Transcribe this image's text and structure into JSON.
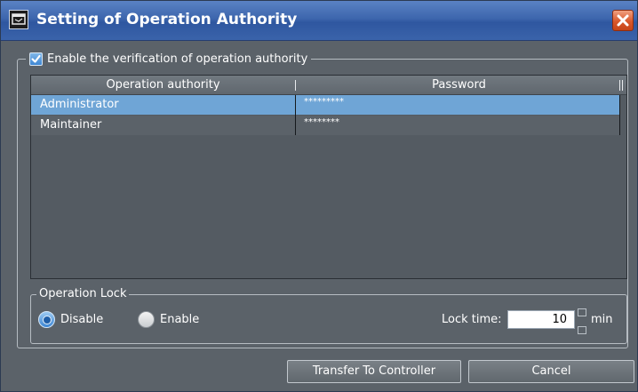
{
  "window": {
    "title": "Setting of Operation Authority"
  },
  "verification": {
    "checkbox_label": "Enable the verification of operation authority",
    "checked": true
  },
  "table": {
    "headers": [
      "Operation authority",
      "Password"
    ],
    "rows": [
      {
        "authority": "Administrator",
        "password": "*********",
        "selected": true
      },
      {
        "authority": "Maintainer",
        "password": "********",
        "selected": false
      }
    ]
  },
  "operation_lock": {
    "group_label": "Operation Lock",
    "options": [
      {
        "label": "Disable",
        "selected": true
      },
      {
        "label": "Enable",
        "selected": false
      }
    ],
    "lock_time_label": "Lock time:",
    "lock_time_value": "10",
    "unit": "min"
  },
  "buttons": {
    "transfer_label": "Transfer To Controller",
    "cancel_label": "Cancel"
  },
  "colors": {
    "titlebar": "#3d66ad",
    "background": "#5b6269",
    "selected_row": "#6fa5d6",
    "close_button": "#d9582c"
  },
  "icons": [
    "app-window-icon",
    "close-icon",
    "checkmark-icon"
  ]
}
